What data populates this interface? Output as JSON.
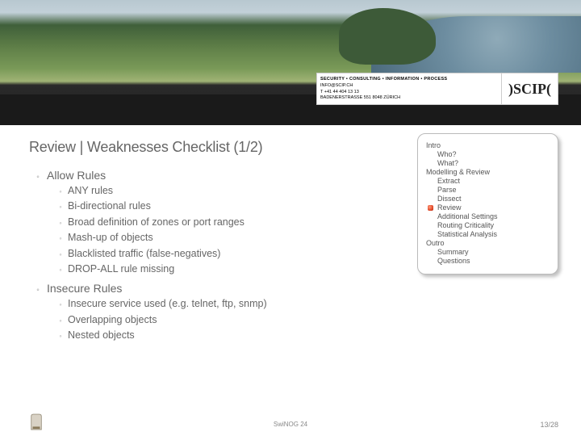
{
  "logo": {
    "line1": "SECURITY • CONSULTING • INFORMATION • PROCESS",
    "line2": "INFO@SCIP.CH",
    "line3": "T +41 44 404 13 13",
    "line4": "BADENERSTRASSE 551  8048 ZÜRICH",
    "mark": ")SCIP("
  },
  "title": "Review | Weaknesses Checklist (1/2)",
  "sections": [
    {
      "heading": "Allow Rules",
      "items": [
        "ANY rules",
        "Bi-directional rules",
        "Broad definition of zones or port ranges",
        "Mash-up of objects",
        "Blacklisted traffic (false-negatives)",
        "DROP-ALL rule missing"
      ]
    },
    {
      "heading": "Insecure Rules",
      "items": [
        "Insecure service used (e.g. telnet, ftp, snmp)",
        "Overlapping objects",
        "Nested objects"
      ]
    }
  ],
  "agenda": [
    {
      "label": "Intro",
      "level": 0
    },
    {
      "label": "Who?",
      "level": 1
    },
    {
      "label": "What?",
      "level": 1
    },
    {
      "label": "Modelling & Review",
      "level": 0
    },
    {
      "label": "Extract",
      "level": 1
    },
    {
      "label": "Parse",
      "level": 1
    },
    {
      "label": "Dissect",
      "level": 1
    },
    {
      "label": "Review",
      "level": 1,
      "current": true
    },
    {
      "label": "Additional Settings",
      "level": 1
    },
    {
      "label": "Routing Criticality",
      "level": 1
    },
    {
      "label": "Statistical Analysis",
      "level": 1
    },
    {
      "label": "Outro",
      "level": 0
    },
    {
      "label": "Summary",
      "level": 1
    },
    {
      "label": "Questions",
      "level": 1
    }
  ],
  "footer": {
    "center": "SwiNOG 24",
    "page": "13/28"
  }
}
